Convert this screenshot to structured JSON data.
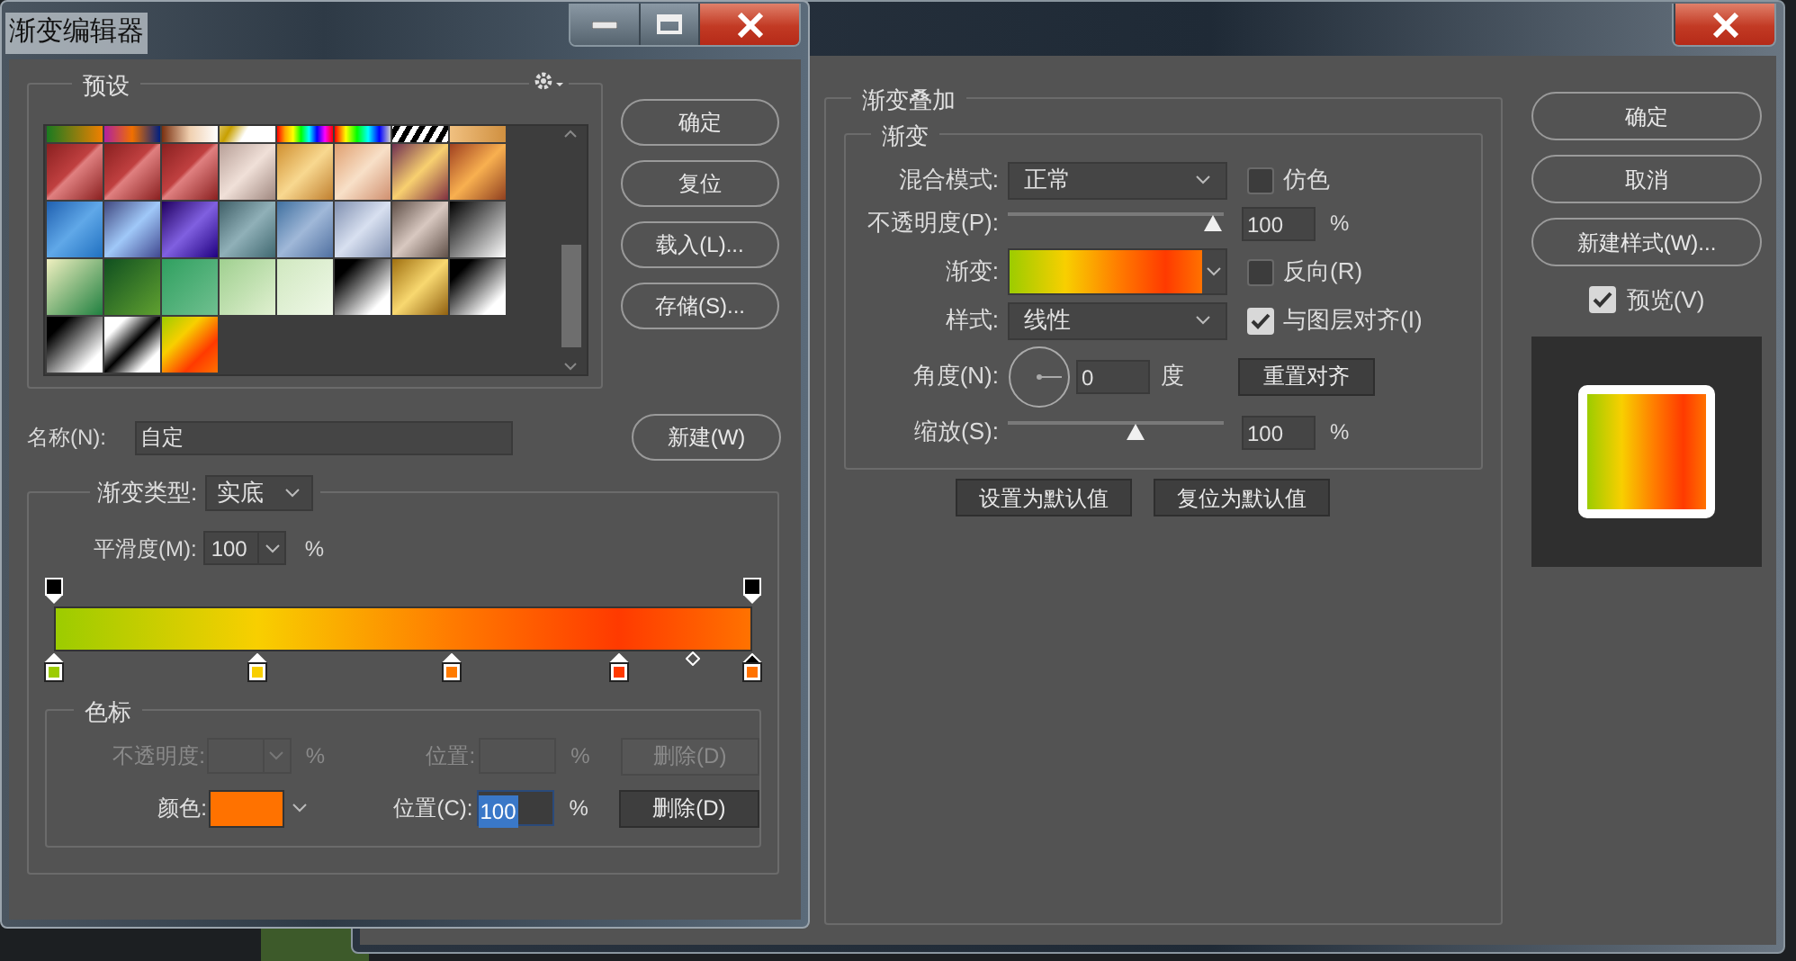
{
  "gradient_editor": {
    "title": "渐变编辑器",
    "presets": {
      "legend": "预设"
    },
    "buttons": [
      "确定",
      "复位",
      "载入(L)...",
      "存储(S)..."
    ],
    "new_button": "新建(W)",
    "name_field": {
      "label": "名称(N):",
      "value": "自定"
    },
    "gradient_type": {
      "label": "渐变类型:",
      "value": "实底"
    },
    "smoothness": {
      "label": "平滑度(M):",
      "value": "100",
      "unit": "%"
    },
    "color_stops": [
      {
        "color": "#9ccc00",
        "selected": false
      },
      {
        "color": "#f8cf00",
        "selected": false
      },
      {
        "color": "#ff7b00",
        "selected": false
      },
      {
        "color": "#ff3a00",
        "selected": false
      },
      {
        "color": "#ff7200",
        "selected": true
      }
    ],
    "stops_group": {
      "legend": "色标",
      "opacity_row": {
        "label": "不透明度:",
        "unit": "%",
        "position_label": "位置:",
        "position_unit": "%",
        "delete": "删除(D)",
        "disabled": true
      },
      "color_row": {
        "label": "颜色:",
        "color": "#ff7200",
        "position_label": "位置(C):",
        "position_value": "100",
        "position_unit": "%",
        "delete": "删除(D)",
        "disabled": false
      }
    }
  },
  "layer_style": {
    "group": "渐变叠加",
    "subgroup": "渐变",
    "blend_mode": {
      "label": "混合模式:",
      "value": "正常"
    },
    "dither": {
      "label": "仿色",
      "checked": false
    },
    "opacity": {
      "label": "不透明度(P):",
      "level": 1.0,
      "value": "100",
      "unit": "%"
    },
    "gradient": {
      "label": "渐变:"
    },
    "reverse": {
      "label": "反向(R)",
      "checked": false
    },
    "style": {
      "label": "样式:",
      "value": "线性"
    },
    "align": {
      "label": "与图层对齐(I)",
      "checked": true
    },
    "angle": {
      "label": "角度(N):",
      "value": "0",
      "unit": "度"
    },
    "reset_align": "重置对齐",
    "scale": {
      "label": "缩放(S):",
      "level": 0.6,
      "value": "100",
      "unit": "%"
    },
    "defaults_buttons": [
      "设置为默认值",
      "复位为默认值"
    ],
    "buttons": [
      "确定",
      "取消",
      "新建样式(W)..."
    ],
    "preview": {
      "label": "预览(V)",
      "checked": true
    }
  }
}
